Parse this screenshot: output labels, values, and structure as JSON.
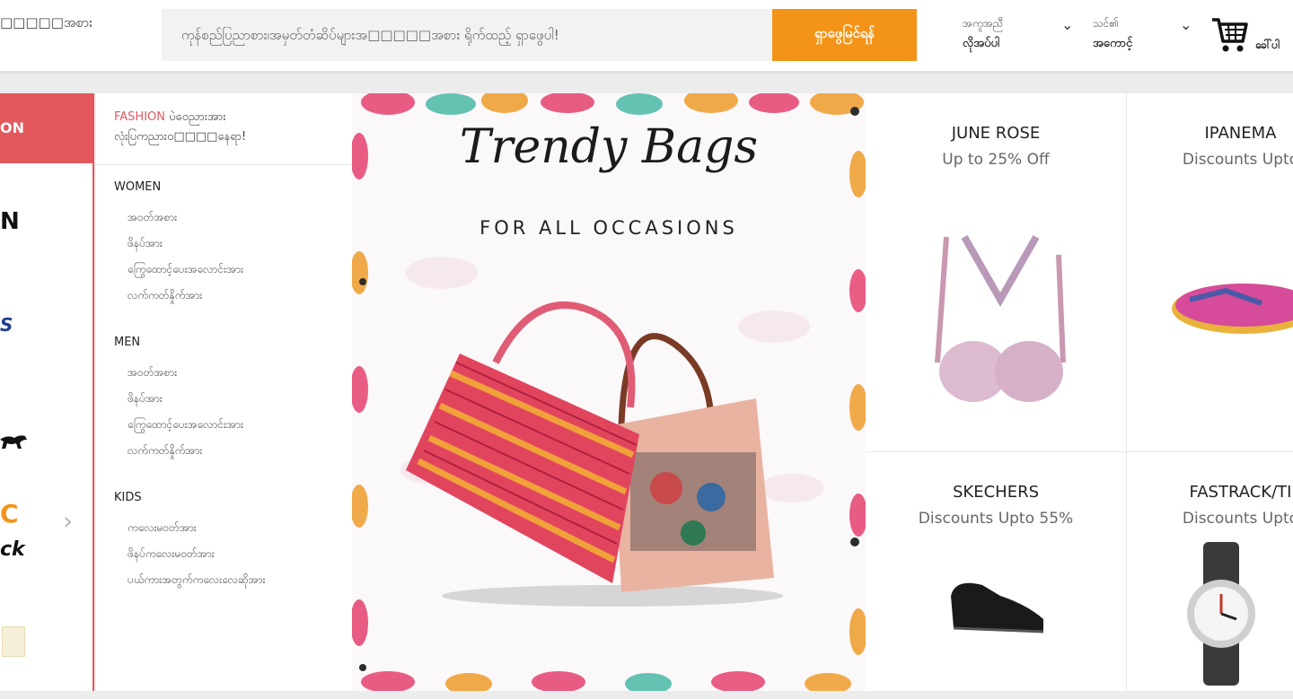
{
  "header": {
    "logo_text": "□□□□□အစား",
    "search_placeholder": "ကုန်စည်ပြညာစား၊အမှတ်တံဆိပ်များအ□□□□□အစား ရိုက်ထည့် ရှာဖွေပါ!",
    "search_button": "ရှာဖွေမြင်ရန်",
    "help_line1": "အကူအညီ",
    "help_line2": "လိုအပ်ပါ",
    "account_line1": "သင်၏",
    "account_line2": "အကောင့်",
    "cart_label": "ခေါ်ပါ"
  },
  "brand_strip": {
    "top_label": "ON",
    "logos": [
      "N",
      "S",
      "",
      "C",
      "ck"
    ]
  },
  "menu": {
    "head_accent": "FASHION",
    "head_line1_rest": " ပဲဝေညားအား",
    "head_line2": "လုံးပြကညားဝ□□□□နေရာ!",
    "sections": [
      {
        "title": "WOMEN",
        "items": [
          "အဝတ်အစား",
          "ဖိနပ်အား",
          "ကြွေထောင့်ပေးအလောင်းအား",
          "လက်ကတ်နှိုက်အား"
        ]
      },
      {
        "title": "MEN",
        "items": [
          "အဝတ်အစား",
          "ဖိနပ်အား",
          "ကြွေထောင့်ပေးအလောင်းအား",
          "လက်ကတ်နှိုက်အား"
        ]
      },
      {
        "title": "KIDS",
        "items": [
          "ကလေးမဝတ်အား",
          "ဖိနပ်ကလေးမဝတ်အား",
          "ပယ်ကားအတွက်ကလေးလေဆိုအား"
        ]
      }
    ]
  },
  "banner": {
    "title": "Trendy Bags",
    "subtitle": "FOR ALL OCCASIONS"
  },
  "products": [
    {
      "name": "JUNE ROSE",
      "offer": "Up to 25% Off"
    },
    {
      "name": "IPANEMA",
      "offer": "Discounts Upto"
    },
    {
      "name": "SKECHERS",
      "offer": "Discounts Upto 55%"
    },
    {
      "name": "FASTRACK/TI",
      "offer": "Discounts Upto"
    }
  ],
  "colors": {
    "accent": "#e2585c",
    "search_button": "#f39419"
  }
}
